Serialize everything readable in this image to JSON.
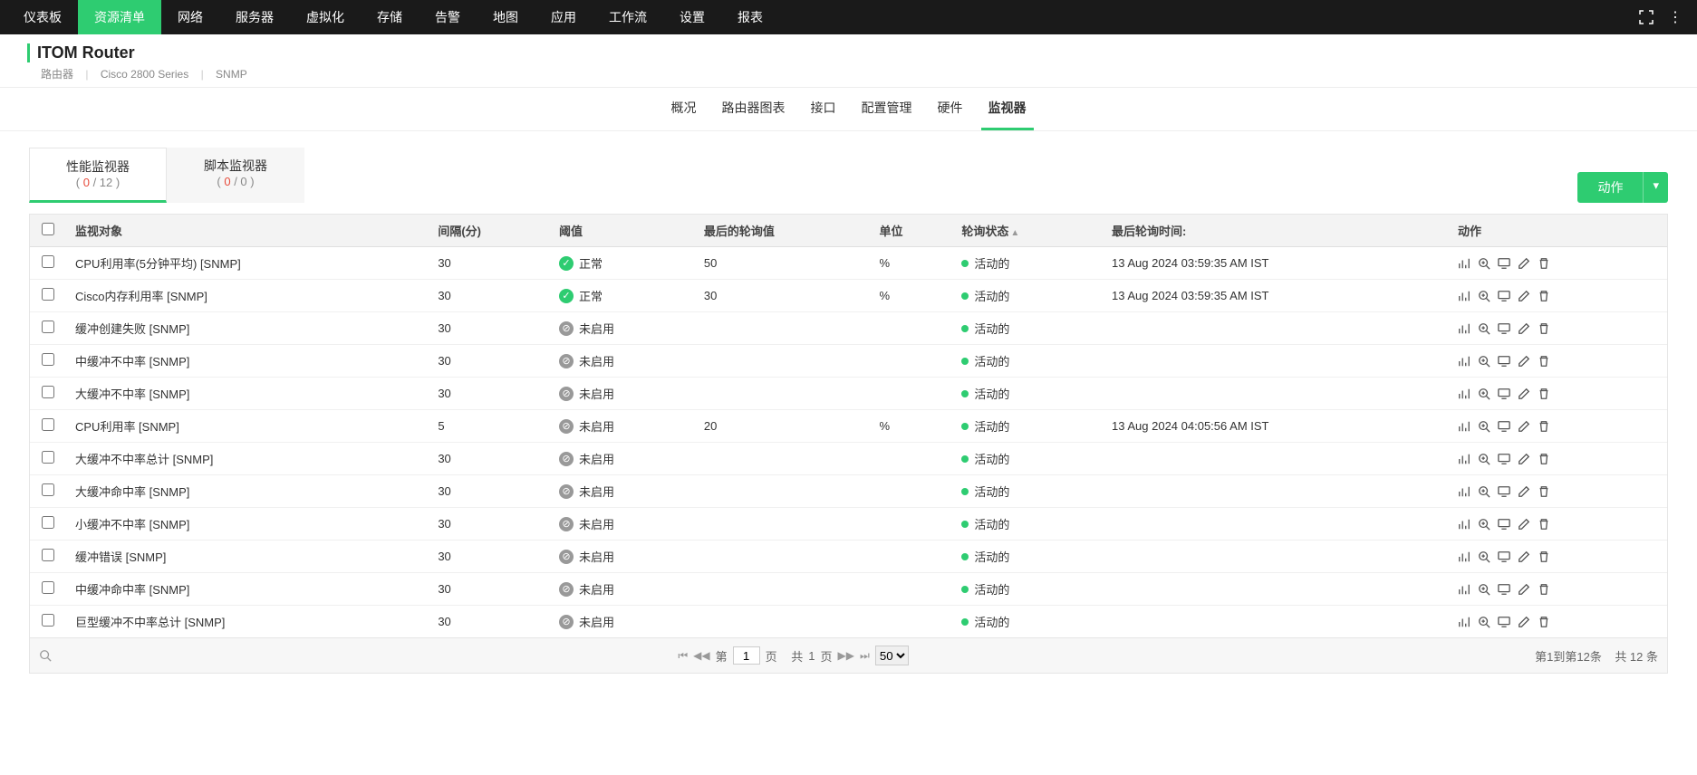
{
  "topnav": {
    "items": [
      "仪表板",
      "资源清单",
      "网络",
      "服务器",
      "虚拟化",
      "存储",
      "告警",
      "地图",
      "应用",
      "工作流",
      "设置",
      "报表"
    ],
    "active_index": 1
  },
  "header": {
    "title": "ITOM Router",
    "crumbs": [
      "路由器",
      "Cisco 2800 Series",
      "SNMP"
    ]
  },
  "subtabs": {
    "items": [
      "概况",
      "路由器图表",
      "接口",
      "配置管理",
      "硬件",
      "监视器"
    ],
    "active_index": 5
  },
  "monitor_tabs": {
    "perf": {
      "label": "性能监视器",
      "down": "0",
      "total": "12"
    },
    "script": {
      "label": "脚本监视器",
      "down": "0",
      "total": "0"
    },
    "active": "perf"
  },
  "action_button": {
    "label": "动作"
  },
  "columns": {
    "object": "监视对象",
    "interval": "间隔(分)",
    "threshold": "阈值",
    "last_poll_value": "最后的轮询值",
    "unit": "单位",
    "poll_status": "轮询状态",
    "last_poll_time": "最后轮询时间:",
    "actions": "动作"
  },
  "threshold_labels": {
    "normal": "正常",
    "not_enabled": "未启用"
  },
  "poll_status_labels": {
    "active": "活动的"
  },
  "rows": [
    {
      "object": "CPU利用率(5分钟平均) [SNMP]",
      "interval": "30",
      "threshold": "normal",
      "last_value": "50",
      "unit": "%",
      "poll_status": "active",
      "last_time": "13 Aug 2024 03:59:35 AM IST"
    },
    {
      "object": "Cisco内存利用率 [SNMP]",
      "interval": "30",
      "threshold": "normal",
      "last_value": "30",
      "unit": "%",
      "poll_status": "active",
      "last_time": "13 Aug 2024 03:59:35 AM IST"
    },
    {
      "object": "缓冲创建失败 [SNMP]",
      "interval": "30",
      "threshold": "not_enabled",
      "last_value": "",
      "unit": "",
      "poll_status": "active",
      "last_time": ""
    },
    {
      "object": "中缓冲不中率 [SNMP]",
      "interval": "30",
      "threshold": "not_enabled",
      "last_value": "",
      "unit": "",
      "poll_status": "active",
      "last_time": ""
    },
    {
      "object": "大缓冲不中率 [SNMP]",
      "interval": "30",
      "threshold": "not_enabled",
      "last_value": "",
      "unit": "",
      "poll_status": "active",
      "last_time": ""
    },
    {
      "object": "CPU利用率 [SNMP]",
      "interval": "5",
      "threshold": "not_enabled",
      "last_value": "20",
      "unit": "%",
      "poll_status": "active",
      "last_time": "13 Aug 2024 04:05:56 AM IST"
    },
    {
      "object": "大缓冲不中率总计 [SNMP]",
      "interval": "30",
      "threshold": "not_enabled",
      "last_value": "",
      "unit": "",
      "poll_status": "active",
      "last_time": ""
    },
    {
      "object": "大缓冲命中率 [SNMP]",
      "interval": "30",
      "threshold": "not_enabled",
      "last_value": "",
      "unit": "",
      "poll_status": "active",
      "last_time": ""
    },
    {
      "object": "小缓冲不中率 [SNMP]",
      "interval": "30",
      "threshold": "not_enabled",
      "last_value": "",
      "unit": "",
      "poll_status": "active",
      "last_time": ""
    },
    {
      "object": "缓冲错误 [SNMP]",
      "interval": "30",
      "threshold": "not_enabled",
      "last_value": "",
      "unit": "",
      "poll_status": "active",
      "last_time": ""
    },
    {
      "object": "中缓冲命中率 [SNMP]",
      "interval": "30",
      "threshold": "not_enabled",
      "last_value": "",
      "unit": "",
      "poll_status": "active",
      "last_time": ""
    },
    {
      "object": "巨型缓冲不中率总计 [SNMP]",
      "interval": "30",
      "threshold": "not_enabled",
      "last_value": "",
      "unit": "",
      "poll_status": "active",
      "last_time": ""
    }
  ],
  "pager": {
    "page_label_pre": "第",
    "page_value": "1",
    "page_label_post": "页",
    "total_pages_pre": "共",
    "total_pages": "1",
    "total_pages_post": "页",
    "page_size": "50",
    "range_text": "第1到第12条",
    "total_text": "共 12 条"
  }
}
